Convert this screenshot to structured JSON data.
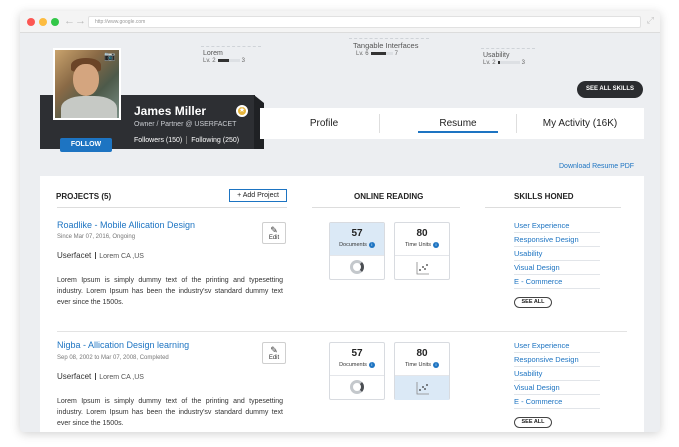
{
  "browser": {
    "url": "http://www.google.com"
  },
  "skills_overview": [
    {
      "name": "Lorem",
      "level_label": "Lv. 2",
      "next_level": "3",
      "progress": 0.5
    },
    {
      "name": "Tangable Interfaces",
      "level_label": "Lv. 6",
      "next_level": "7",
      "progress": 0.7
    },
    {
      "name": "Usability",
      "level_label": "Lv. 2",
      "next_level": "3",
      "progress": 0.1
    }
  ],
  "see_all_skills_label": "SEE ALL SKILLS",
  "profile": {
    "name": "James Miller",
    "role": "Owner / Partner @ USERFACET",
    "followers": "Followers (150)",
    "following": "Following (250)",
    "follow_label": "FOLLOW",
    "badge_icon": "star-badge-icon",
    "camera_icon": "camera-icon"
  },
  "tabs": [
    "Profile",
    "Resume",
    "My Activity (16K)"
  ],
  "active_tab": "Resume",
  "download_label": "Download Resume PDF",
  "columns": {
    "projects": "PROJECTS (5)",
    "add_project": "Add Project",
    "online_reading": "ONLINE READING",
    "skills_honed": "SKILLS HONED"
  },
  "projects": [
    {
      "title": "Roadlike -  Mobile Allication Design",
      "date": "Since Mar 07, 2016, Ongoing",
      "company": "Userfacet",
      "location": "Lorem CA ,US",
      "description": "Lorem Ipsum is simply dummy text of the printing and typesetting industry. Lorem Ipsum has been the industry'sv standard dummy text ever since the 1500s.",
      "edit_label": "Edit",
      "documents": "57",
      "documents_label": "Documents",
      "time_units": "80",
      "time_units_label": "Time Units",
      "skills": [
        "User Experience",
        "Responsive Design",
        "Usability",
        "Visual Design",
        "E - Commerce"
      ],
      "see_all_label": "SEE ALL"
    },
    {
      "title": "Nigba  - Allication Design learning",
      "date": "Sep 08, 2002 to Mar 07, 2008, Completed",
      "company": "Userfacet",
      "location": "Lorem CA ,US",
      "description": "Lorem Ipsum is simply dummy text of the printing and typesetting industry. Lorem Ipsum has been the industry'sv standard dummy text ever since the 1500s.",
      "edit_label": "Edit",
      "documents": "57",
      "documents_label": "Documents",
      "time_units": "80",
      "time_units_label": "Time Units",
      "skills": [
        "User Experience",
        "Responsive Design",
        "Usability",
        "Visual Design",
        "E - Commerce"
      ],
      "see_all_label": "SEE ALL"
    }
  ],
  "colors": {
    "accent": "#1d74c2",
    "card_dark": "#2d2f33",
    "highlight": "#dbe9f6"
  }
}
